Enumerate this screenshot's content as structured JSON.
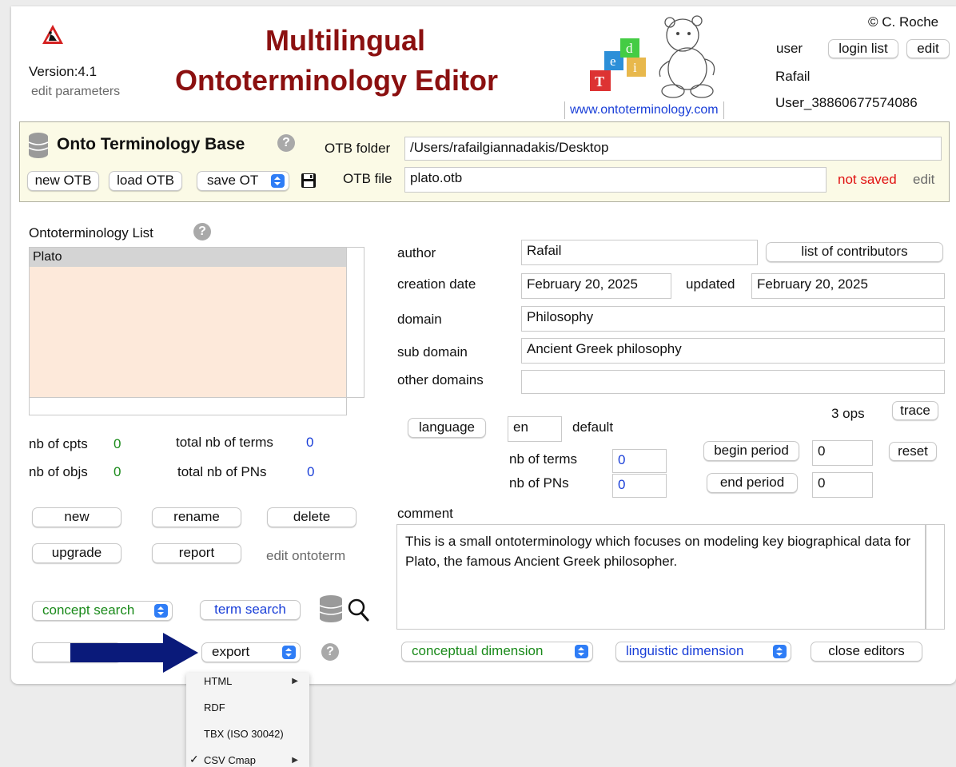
{
  "header": {
    "copyright": "© C. Roche",
    "version": "Version:4.1",
    "edit_parameters": "edit parameters",
    "title_line1": "Multilingual",
    "title_line2": "Ontoterminology Editor",
    "website": "www.ontoterminology.com",
    "user_label": "user",
    "login_list": "login list",
    "edit": "edit",
    "user_name": "Rafail",
    "user_id": "User_38860677574086"
  },
  "otb": {
    "title": "Onto Terminology Base",
    "folder_label": "OTB folder",
    "folder_value": "/Users/rafailgiannadakis/Desktop",
    "file_label": "OTB file",
    "file_value": "plato.otb",
    "new_btn": "new OTB",
    "load_btn": "load OTB",
    "save_select": "save OT",
    "status": "not saved",
    "edit": "edit"
  },
  "list": {
    "label": "Ontoterminology List",
    "items": [
      "Plato"
    ]
  },
  "stats": {
    "cpts_label": "nb of cpts",
    "cpts": "0",
    "terms_label": "total nb of terms",
    "terms": "0",
    "objs_label": "nb of objs",
    "objs": "0",
    "pns_label": "total nb of PNs",
    "pns": "0"
  },
  "actions": {
    "new": "new",
    "rename": "rename",
    "delete": "delete",
    "upgrade": "upgrade",
    "report": "report",
    "edit_ontoterm": "edit ontoterm",
    "concept_search": "concept search",
    "term_search": "term search",
    "export": "export"
  },
  "details": {
    "author_label": "author",
    "author": "Rafail",
    "contributors_btn": "list of contributors",
    "creation_label": "creation date",
    "creation": "February 20, 2025",
    "updated_label": "updated",
    "updated": "February 20, 2025",
    "domain_label": "domain",
    "domain": "Philosophy",
    "subdomain_label": "sub domain",
    "subdomain": "Ancient Greek philosophy",
    "other_label": "other domains",
    "other": "",
    "ops": "3 ops",
    "trace": "trace",
    "language_btn": "language",
    "language": "en",
    "default": "default",
    "nb_terms_label": "nb of terms",
    "nb_terms": "0",
    "nb_pns_label": "nb of PNs",
    "nb_pns": "0",
    "begin_period": "begin period",
    "begin_value": "0",
    "end_period": "end period",
    "end_value": "0",
    "reset": "reset",
    "comment_label": "comment",
    "comment": "This is a small ontoterminology which focuses on modeling key biographical data for Plato, the famous Ancient Greek philosopher."
  },
  "footer": {
    "conceptual": "conceptual dimension",
    "linguistic": "linguistic dimension",
    "close": "close editors"
  },
  "export_menu": {
    "items": [
      "HTML",
      "RDF",
      "TBX (ISO 30042)",
      "CSV Cmap"
    ],
    "checked": "✓"
  },
  "colors": {
    "brand_red": "#8b1010",
    "arrow": "#0a1a7a",
    "list_bg": "#fde9da",
    "otb_bg": "#fbfae6"
  }
}
